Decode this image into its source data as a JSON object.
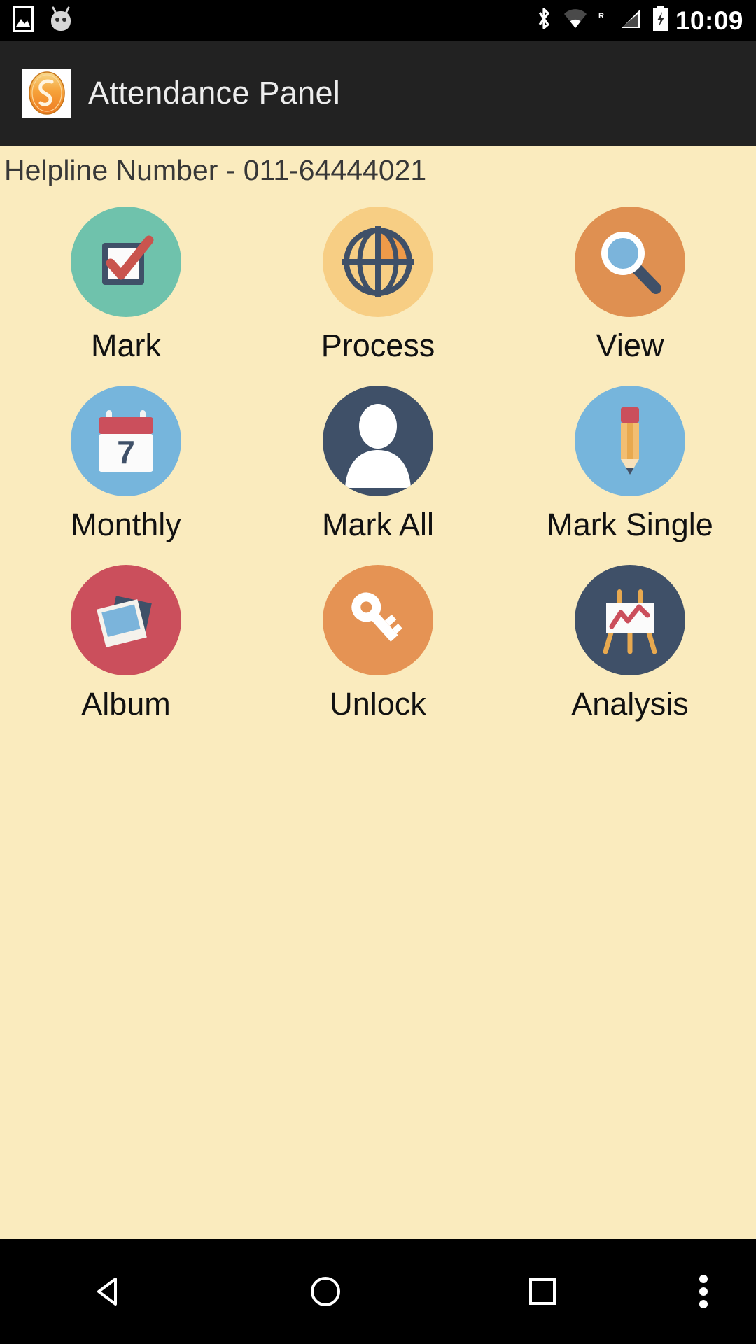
{
  "status_bar": {
    "time": "10:09",
    "icons": [
      "image-icon",
      "android-head-icon",
      "bluetooth-icon",
      "wifi-icon",
      "roaming-r-icon",
      "signal-icon",
      "battery-charging-icon"
    ]
  },
  "app_bar": {
    "title": "Attendance Panel",
    "logo_icon": "app-logo-icon",
    "background_color": "#222222",
    "title_color": "#EDEDED"
  },
  "content": {
    "background_color": "#FAEBBE",
    "helpline_text": "Helpline Number - 011-64444021"
  },
  "grid": {
    "items": [
      {
        "label": "Mark",
        "icon": "checkbox-check-icon",
        "circle_color": "#6FC2AC"
      },
      {
        "label": "Process",
        "icon": "crosshair-target-icon",
        "circle_color": "#F7CE84"
      },
      {
        "label": "View",
        "icon": "magnifier-icon",
        "circle_color": "#DF9051"
      },
      {
        "label": "Monthly",
        "icon": "calendar-icon",
        "circle_color": "#76B5DC"
      },
      {
        "label": "Mark All",
        "icon": "person-avatar-icon",
        "circle_color": "#3F5068"
      },
      {
        "label": "Mark Single",
        "icon": "pencil-icon",
        "circle_color": "#76B5DC"
      },
      {
        "label": "Album",
        "icon": "photos-icon",
        "circle_color": "#CB4F5C"
      },
      {
        "label": "Unlock",
        "icon": "key-icon",
        "circle_color": "#E59354"
      },
      {
        "label": "Analysis",
        "icon": "easel-chart-icon",
        "circle_color": "#3F5068"
      }
    ]
  },
  "nav_bar": {
    "background_color": "#000000",
    "buttons": [
      {
        "name": "back",
        "icon": "back-triangle-icon"
      },
      {
        "name": "home",
        "icon": "home-circle-icon"
      },
      {
        "name": "recents",
        "icon": "recents-square-icon"
      },
      {
        "name": "overflow",
        "icon": "overflow-dots-icon"
      }
    ]
  }
}
